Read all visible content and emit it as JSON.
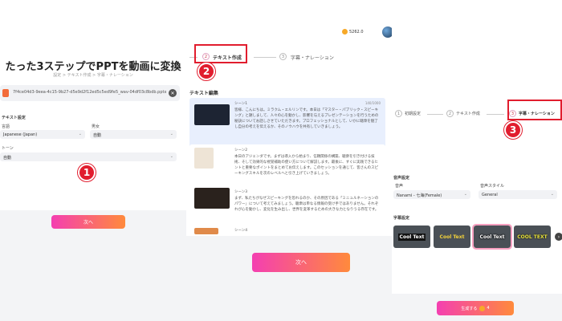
{
  "panel1": {
    "title": "たった3ステップでPPTを動画に変換",
    "steps_line": "設定 > テキスト作成 > 字幕・ナレーション",
    "file_name": "7f4ce04d3-9eea-4c15-9b27-d5e9d2f12ed5c5ed9fe5_wav-04df03c8bdb.pptx",
    "text_settings_label": "テキスト設定",
    "language_label": "言語",
    "language_value": "Japanese (Japan)",
    "voice_label": "男女",
    "voice_value": "自動",
    "tone_label": "トーン",
    "tone_value": "自動",
    "next_button": "次へ",
    "annotation": "1"
  },
  "panel2": {
    "coins": "5262.0",
    "step2_num": "2",
    "step2_label": "テキスト作成",
    "step3_num": "3",
    "step3_label": "字幕・ナレーション",
    "section_title": "テキスト編集",
    "scenes": [
      {
        "title": "シーン1",
        "count": "140/1000",
        "text": "皆様、こんにちは。ミラクム・エルリンです。本日は「マスター・パブリック・スピーキング」と題しまして、人々の心を動かし、影響を与えるプレゼンテーションを行うための秘訣についてお話しさせていただきます。プロフェッショナルとして、いかに聴衆を魅了し自分の考えを伝えるか、そのノウハウを共有していきましょう。"
      },
      {
        "title": "シーン2",
        "count": "",
        "text": "本日のアジェンダです。まずは導入から始まり、信頼関係の構築、聴衆を引き付ける技術、そして効果的な視覚補助の使い方について解説します。最後に、すぐに実践できるヒントと重要なポイントをまとめてお伝えします。このセッションを通じて、皆さんのスピーキングスキルを次のレベルへと引き上げていきましょう。"
      },
      {
        "title": "シーン3",
        "count": "",
        "text": "まず、私たちがなぜスピーキングを恐れるのか、その原因である「ミニュルネーションのパワー」について考えてみましょう。聴衆は単なる情報の受け手ではありません。それぞれが心を動かし、変化を生み出し、世界を変革するための大きな力となりうる存在です。"
      },
      {
        "title": "シーン4",
        "count": "",
        "text": ""
      }
    ],
    "next_button": "次へ",
    "annotation": "2"
  },
  "panel3": {
    "step1_num": "1",
    "step1_label": "初期設定",
    "step2_num": "2",
    "step2_label": "テキスト作成",
    "step3_num": "3",
    "step3_label": "字幕・ナレーション",
    "voice_settings_label": "音声設定",
    "voice_label": "音声",
    "voice_value": "Nanami - 七海(Female)",
    "style_label": "音声スタイル",
    "style_value": "General",
    "subtitle_settings_label": "字幕設定",
    "chips": [
      "Cool Text",
      "Cool Text",
      "Cool Text",
      "COOL TEXT"
    ],
    "generate_button": "生成する",
    "generate_cost": "4",
    "annotation": "3"
  }
}
